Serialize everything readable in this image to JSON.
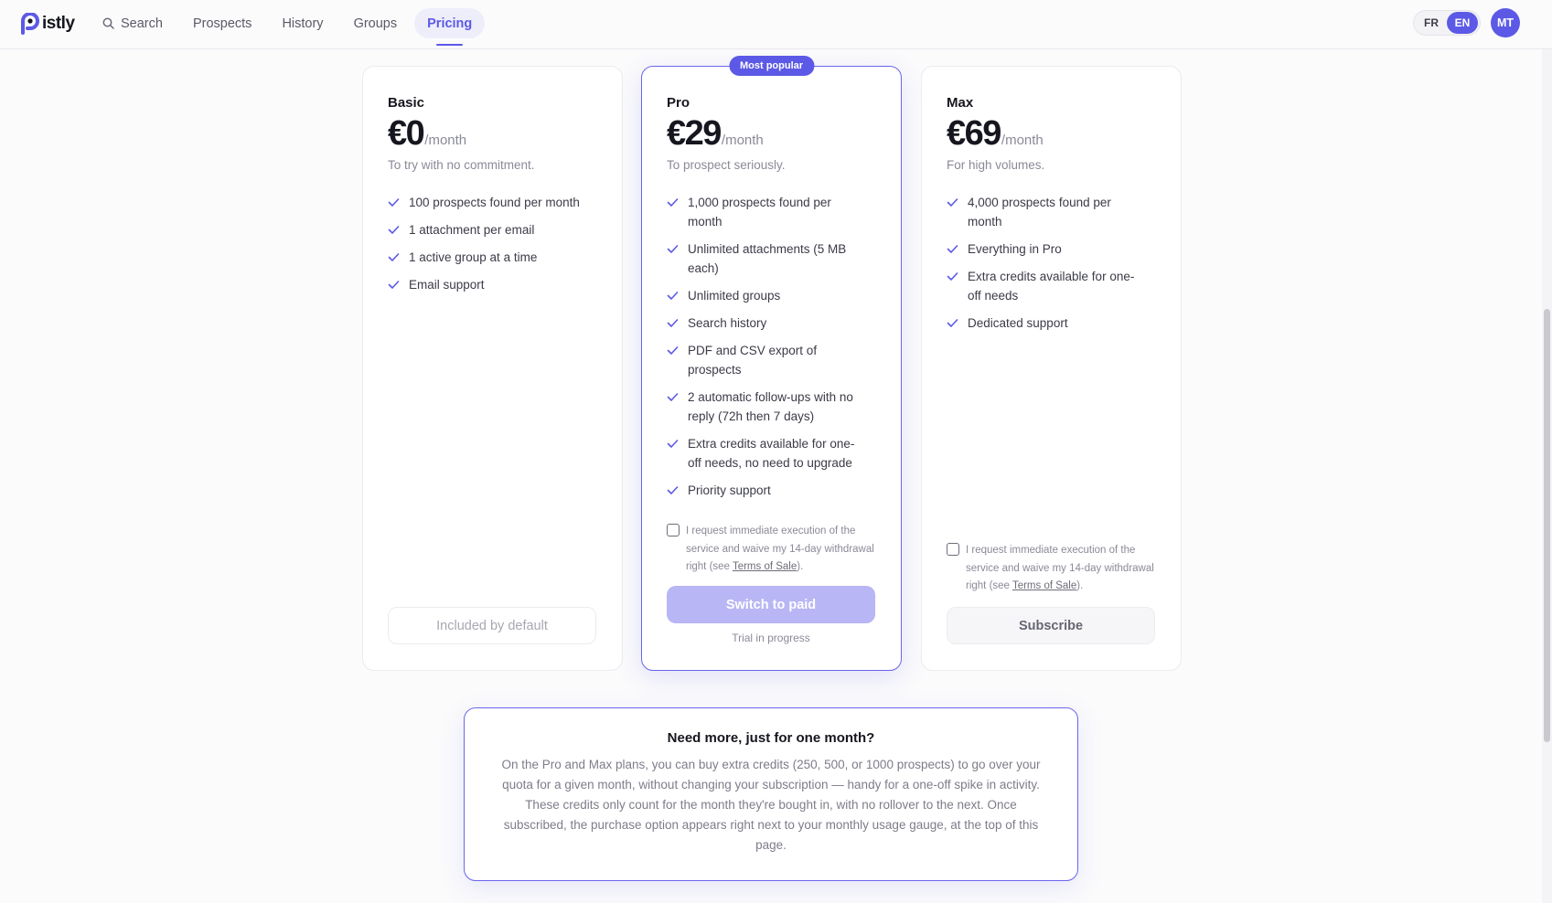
{
  "brand": {
    "name": "istly",
    "accent": "#5c59e6"
  },
  "nav": {
    "items": [
      {
        "label": "Search",
        "icon": "search-icon",
        "active": false
      },
      {
        "label": "Prospects",
        "active": false
      },
      {
        "label": "History",
        "active": false
      },
      {
        "label": "Groups",
        "active": false
      },
      {
        "label": "Pricing",
        "active": true
      }
    ]
  },
  "lang": {
    "options": [
      "FR",
      "EN"
    ],
    "selected": "EN"
  },
  "user": {
    "initials": "MT"
  },
  "plans": [
    {
      "name": "Basic",
      "price": "€0",
      "period": "/month",
      "tagline": "To try with no commitment.",
      "features": [
        "100 prospects found per month",
        "1 attachment per email",
        "1 active group at a time",
        "Email support"
      ],
      "button": "Included by default"
    },
    {
      "name": "Pro",
      "badge": "Most popular",
      "price": "€29",
      "period": "/month",
      "tagline": "To prospect seriously.",
      "features": [
        "1,000 prospects found per month",
        "Unlimited attachments (5 MB each)",
        "Unlimited groups",
        "Search history",
        "PDF and CSV export of prospects",
        "2 automatic follow-ups with no reply (72h then 7 days)",
        "Extra credits available for one-off needs, no need to upgrade",
        "Priority support"
      ],
      "consent": {
        "text_before": "I request immediate execution of the service and waive my 14-day withdrawal right (see ",
        "link": "Terms of Sale",
        "text_after": ")."
      },
      "button": "Switch to paid",
      "note": "Trial in progress"
    },
    {
      "name": "Max",
      "price": "€69",
      "period": "/month",
      "tagline": "For high volumes.",
      "features": [
        "4,000 prospects found per month",
        "Everything in Pro",
        "Extra credits available for one-off needs",
        "Dedicated support"
      ],
      "consent": {
        "text_before": "I request immediate execution of the service and waive my 14-day withdrawal right (see ",
        "link": "Terms of Sale",
        "text_after": ")."
      },
      "button": "Subscribe"
    }
  ],
  "info": {
    "title": "Need more, just for one month?",
    "body": "On the Pro and Max plans, you can buy extra credits (250, 500, or 1000 prospects) to go over your quota for a given month, without changing your subscription — handy for a one-off spike in activity. These credits only count for the month they're bought in, with no rollover to the next. Once subscribed, the purchase option appears right next to your monthly usage gauge, at the top of this page."
  }
}
